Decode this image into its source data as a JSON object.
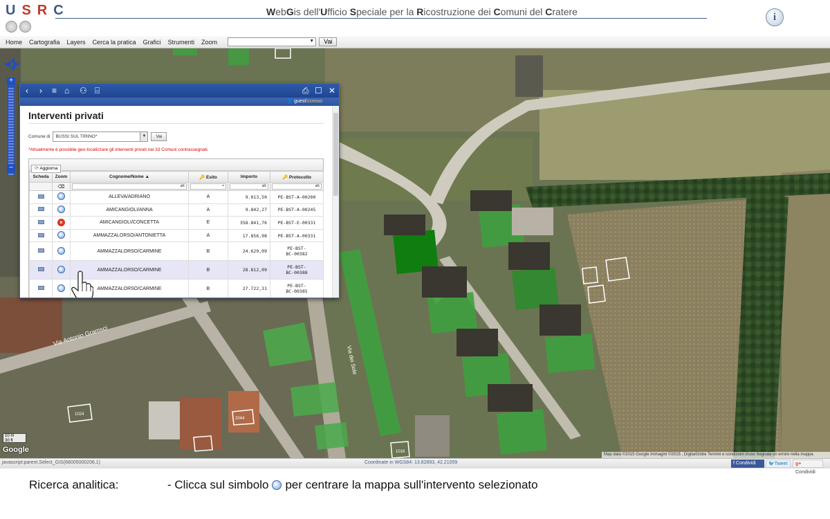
{
  "header": {
    "logo_letters": [
      "U",
      "S",
      "R",
      "C"
    ],
    "title_parts": [
      {
        "b": "W",
        "t": "eb"
      },
      {
        "b": "G",
        "t": "is dell'"
      },
      {
        "b": "U",
        "t": "fficio "
      },
      {
        "b": "S",
        "t": "peciale per la "
      },
      {
        "b": "R",
        "t": "icostruzione dei "
      },
      {
        "b": "C",
        "t": "omuni del "
      },
      {
        "b": "C",
        "t": "ratere"
      }
    ],
    "info_glyph": "i"
  },
  "menu": {
    "items": [
      "Home",
      "Cartografia",
      "Layers",
      "Cerca la pratica",
      "Grafici",
      "Strumenti",
      "Zoom"
    ],
    "go_label": "Vai"
  },
  "map": {
    "scale_m": "10 m",
    "scale_ft": "30 ft",
    "google": "Google",
    "attribution": "Map data ©2015 Google Immagini ©2015 , DigitalGlobe   Termini e condizioni d'uso   Segnala un errore nella mappa",
    "road_labels": [
      "Via Antonio Gramsci",
      "Via dei Sole"
    ],
    "parcel_labels": [
      "1024",
      "2044",
      "1016"
    ]
  },
  "panel": {
    "guest_prefix": "guest",
    "guest_suffix": "/ccesso",
    "title": "Interventi privati",
    "comune_label": "Comune di",
    "comune_value": "BUSSI SUL TIRINO*",
    "vai_label": "Vai",
    "note": "*Attualmente è possibile geo-localizzare gli interventi privati nei 33 Comuni contrassegnati.",
    "aggiorna": "Aggiorna",
    "columns": [
      "Scheda",
      "Zoom",
      "Cognome/Nome ▲",
      "Esito",
      "Importo",
      "Protocollo"
    ],
    "filters": [
      "alk",
      "=",
      "alk",
      "alk"
    ],
    "rows": [
      {
        "zoom": "zoom",
        "name": "ALLEVA/ADRIANO",
        "esito": "A",
        "importo": "9.013,50",
        "protocollo": "PE-BST-A-00200"
      },
      {
        "zoom": "zoom",
        "name": "AMICANGIOLI/ANNA",
        "esito": "A",
        "importo": "9.842,27",
        "protocollo": "PE-BST-A-00245"
      },
      {
        "zoom": "error",
        "name": "AMICANGIOLI/CONCETTA",
        "esito": "E",
        "importo": "358.841,76",
        "protocollo": "PE-BST-E-00331"
      },
      {
        "zoom": "zoom",
        "name": "AMMAZZALORSO/ANTONIETTA",
        "esito": "A",
        "importo": "17.856,98",
        "protocollo": "PE-BST-A-00331"
      },
      {
        "zoom": "zoom",
        "name": "AMMAZZALORSO/CARMINE",
        "esito": "B",
        "importo": "24.629,09",
        "protocollo": "PE-BST-BC-00382"
      },
      {
        "zoom": "zoom",
        "name": "AMMAZZALORSO/CARMINE",
        "esito": "B",
        "importo": "28.812,09",
        "protocollo": "PE-BST-BC-00388"
      },
      {
        "zoom": "zoom",
        "name": "AMMAZZALORSO/CARMINE",
        "esito": "B",
        "importo": "27.722,31",
        "protocollo": "PE-BST-BC-00385"
      }
    ],
    "selected_row": 5
  },
  "statusbar": {
    "left": "javascript:parent.Select_GIS(68005000206,1)",
    "coords": "Coordinate in WGS84: 13.82893, 42.21059",
    "facebook": "Condividi",
    "twitter": "Tweet",
    "gplus_g": "g+",
    "gplus": "Condividi"
  },
  "caption": {
    "label": "Ricerca analitica:",
    "before_icon": "- Clicca sul simbolo",
    "after_icon": "per centrare la mappa sull'intervento selezionato"
  },
  "colors": {
    "brand_blue": "#3d5a86",
    "panel_bar": "#1f4590",
    "parcel_green": "#2e9b2e",
    "error_red": "#d9361f"
  }
}
